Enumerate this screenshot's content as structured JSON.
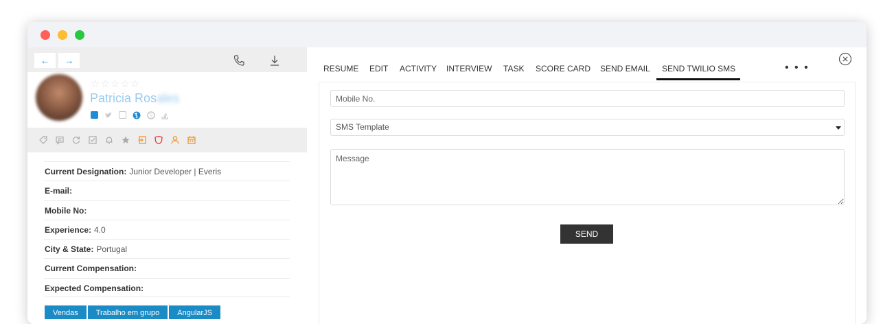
{
  "profile": {
    "name": "Patricia Rosales",
    "name_first_visible": "Patricia Ros",
    "name_rest_blurred": "ales"
  },
  "details": [
    {
      "label": "Current Designation:",
      "value": "Junior Developer | Everis"
    },
    {
      "label": "E-mail:",
      "value": ""
    },
    {
      "label": "Mobile No:",
      "value": ""
    },
    {
      "label": "Experience:",
      "value": "4.0"
    },
    {
      "label": "City & State:",
      "value": "Portugal"
    },
    {
      "label": "Current Compensation:",
      "value": ""
    },
    {
      "label": "Expected Compensation:",
      "value": ""
    }
  ],
  "tags": [
    "Vendas",
    "Trabalho em grupo",
    "AngularJS"
  ],
  "tabs": [
    "RESUME",
    "EDIT",
    "ACTIVITY",
    "INTERVIEW",
    "TASK",
    "SCORE CARD",
    "SEND EMAIL",
    "SEND TWILIO SMS"
  ],
  "active_tab": "SEND TWILIO SMS",
  "more_label": "• • •",
  "form": {
    "mobile_placeholder": "Mobile No.",
    "template_value": "SMS Template",
    "message_placeholder": "Message",
    "send_label": "SEND"
  },
  "colors": {
    "accent": "#2a8fd6",
    "tag_bg": "#1b8bc6",
    "orange_icon": "#f0962f",
    "red_icon": "#e23b3b",
    "send_bg": "#333333"
  },
  "icons": {
    "nav_back": "arrow-left-icon",
    "nav_forward": "arrow-right-icon",
    "toolbar": [
      "phone-icon",
      "download-icon"
    ],
    "socials": [
      "linkedin-icon",
      "twitter-icon",
      "facebook-icon",
      "globe-icon",
      "skype-icon",
      "stackoverflow-icon"
    ],
    "actions": [
      "tag-icon",
      "comment-icon",
      "refresh-icon",
      "checkbox-icon",
      "bell-icon",
      "star-icon",
      "login-icon",
      "shield-icon",
      "user-icon",
      "calendar-icon"
    ]
  }
}
